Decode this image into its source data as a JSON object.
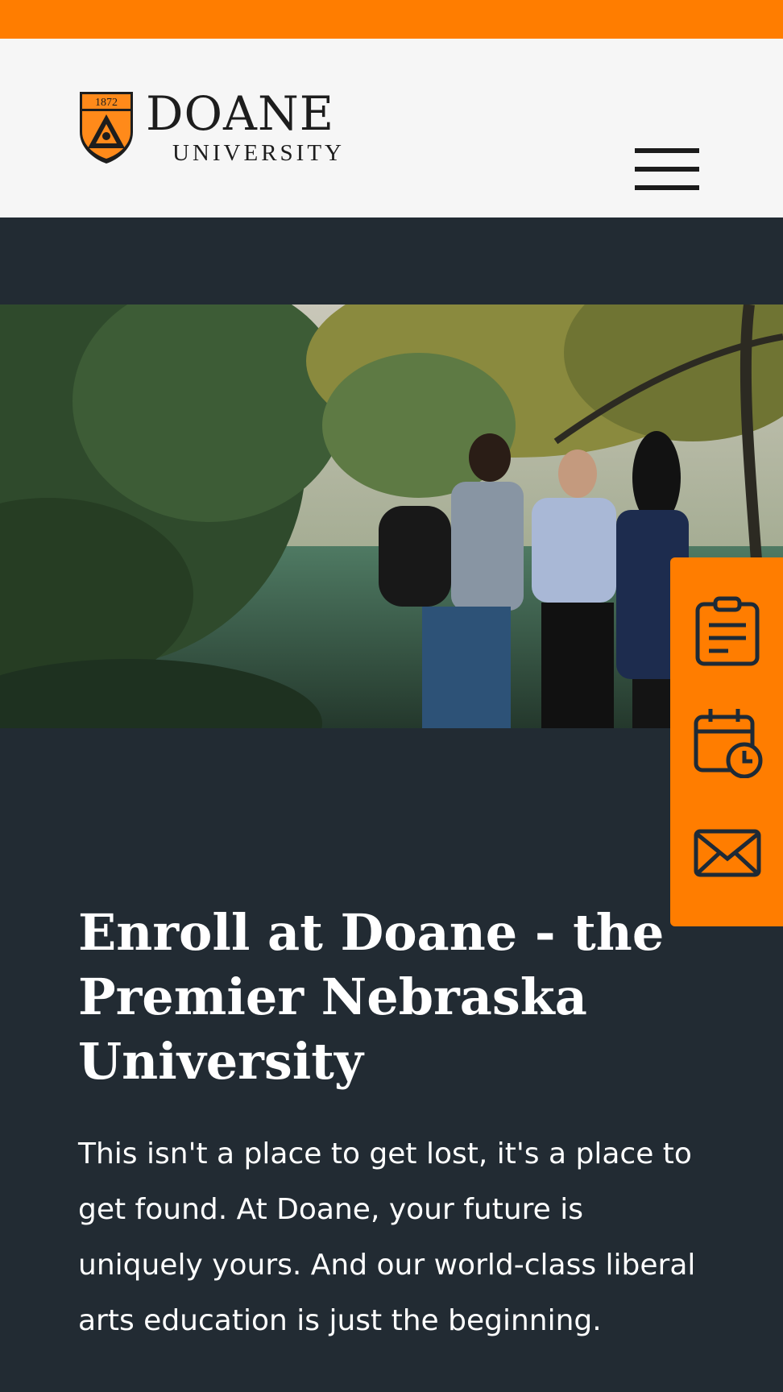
{
  "colors": {
    "accent": "#ff7d00",
    "header_bg": "#f6f6f6",
    "page_bg": "#222b33",
    "text": "#ffffff"
  },
  "header": {
    "logo": {
      "year": "1872",
      "name": "DOANE",
      "subtitle": "UNIVERSITY"
    },
    "menu_icon": "hamburger-menu-icon"
  },
  "hero": {
    "image": "students-talking-by-campus-pond-photo"
  },
  "side_tools": [
    {
      "icon": "clipboard-icon"
    },
    {
      "icon": "calendar-clock-icon"
    },
    {
      "icon": "envelope-icon"
    }
  ],
  "main": {
    "title": "Enroll at Doane - the Premier Nebraska University",
    "body": "This isn't a place to get lost, it's a place to get found. At Doane, your future is uniquely yours. And our world-class liberal arts education is just the beginning."
  }
}
